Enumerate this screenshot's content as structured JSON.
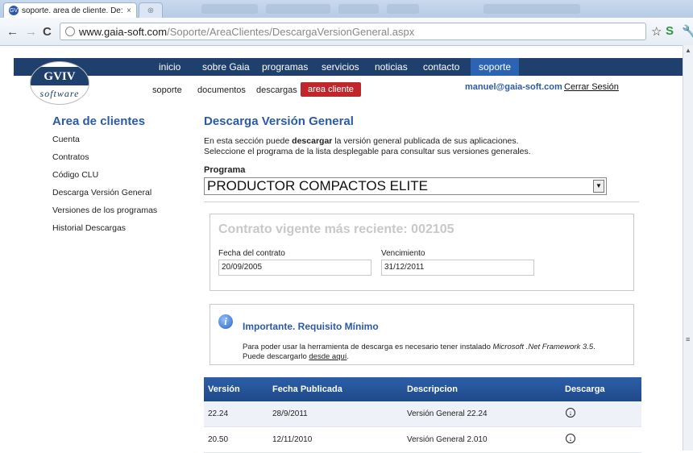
{
  "browser": {
    "tab_title": "soporte. area de cliente. De:",
    "favicon_text": "GV",
    "url_host": "www.gaia-soft.com",
    "url_path": "/Soporte/AreaClientes/DescargaVersionGeneral.aspx"
  },
  "logo": {
    "top": "GVIV",
    "bottom": "software"
  },
  "topnav": {
    "items": [
      "inicio",
      "sobre Gaia",
      "programas",
      "servicios",
      "noticias",
      "contacto",
      "soporte"
    ]
  },
  "subnav": {
    "items": [
      "soporte",
      "documentos",
      "descargas",
      "area cliente"
    ]
  },
  "user": {
    "email": "manuel@gaia-soft.com",
    "logout": "Cerrar Sesión"
  },
  "sidebar": {
    "title": "Area de clientes",
    "items": [
      "Cuenta",
      "Contratos",
      "Código CLU",
      "Descarga Versión General",
      "Versiones de los programas",
      "Historial Descargas"
    ]
  },
  "main": {
    "title": "Descarga Versión General",
    "intro_pre": "En esta sección puede ",
    "intro_bold": "descargar",
    "intro_post": " la versión general publicada de sus aplicaciones.",
    "intro_line2": "Seleccione el programa de la lista desplegable para consultar sus versiones generales.",
    "program_label": "Programa",
    "program_value": "PRODUCTOR COMPACTOS ELITE"
  },
  "contract": {
    "title": "Contrato vigente más reciente: 002105",
    "date_label": "Fecha del contrato",
    "date_value": "20/09/2005",
    "expiry_label": "Vencimiento",
    "expiry_value": "31/12/2011"
  },
  "requirement": {
    "title": "Importante. Requisito Mínimo",
    "text_pre": "Para poder usar la herramienta de descarga es necesario tener instalado ",
    "text_italic": "Microsoft .Net Framework 3.5",
    "text_post": ".",
    "text_line2_pre": "Puede descargarlo ",
    "text_link": "desde aquí",
    "text_line2_post": "."
  },
  "table": {
    "headers": [
      "Versión",
      "Fecha Publicada",
      "Descripcion",
      "Descarga"
    ],
    "rows": [
      [
        "22.24",
        "28/9/2011",
        "Versión General 22.24"
      ],
      [
        "20.50",
        "12/11/2010",
        "Versión General 2.010"
      ]
    ]
  }
}
